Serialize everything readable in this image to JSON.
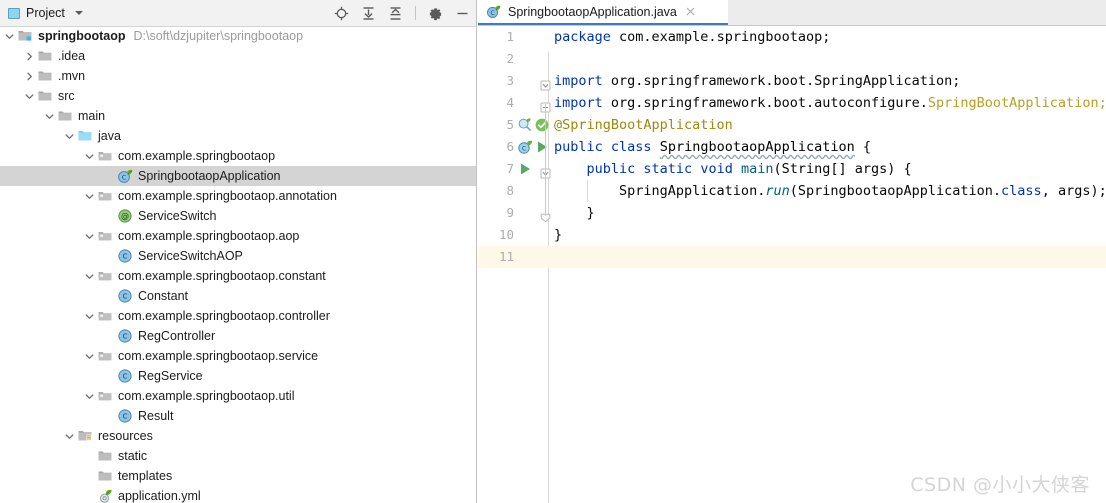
{
  "project_panel": {
    "title": "Project",
    "window_icon": "project-window-icon",
    "actions": [
      {
        "name": "locate-icon",
        "label": "Select Opened File"
      },
      {
        "name": "expand-all-icon",
        "label": "Expand All"
      },
      {
        "name": "collapse-all-icon",
        "label": "Collapse All"
      },
      {
        "name": "gear-icon",
        "label": "Options"
      },
      {
        "name": "minimize-icon",
        "label": "Hide"
      }
    ],
    "tree": [
      {
        "label": "springbootaop",
        "path": "D:\\soft\\dzjupiter\\springbootaop",
        "icon": "module-folder-icon",
        "arrow": "expanded",
        "depth": 0,
        "bold": true,
        "selected": false
      },
      {
        "label": ".idea",
        "path": "",
        "icon": "folder-icon",
        "arrow": "collapsed",
        "depth": 1,
        "bold": false,
        "selected": false
      },
      {
        "label": ".mvn",
        "path": "",
        "icon": "folder-icon",
        "arrow": "collapsed",
        "depth": 1,
        "bold": false,
        "selected": false
      },
      {
        "label": "src",
        "path": "",
        "icon": "folder-icon",
        "arrow": "expanded",
        "depth": 1,
        "bold": false,
        "selected": false
      },
      {
        "label": "main",
        "path": "",
        "icon": "folder-icon",
        "arrow": "expanded",
        "depth": 2,
        "bold": false,
        "selected": false
      },
      {
        "label": "java",
        "path": "",
        "icon": "source-folder-icon",
        "arrow": "expanded",
        "depth": 3,
        "bold": false,
        "selected": false
      },
      {
        "label": "com.example.springbootaop",
        "path": "",
        "icon": "package-icon",
        "arrow": "expanded",
        "depth": 4,
        "bold": false,
        "selected": false
      },
      {
        "label": "SpringbootaopApplication",
        "path": "",
        "icon": "spring-class-icon",
        "arrow": "none",
        "depth": 5,
        "bold": false,
        "selected": true
      },
      {
        "label": "com.example.springbootaop.annotation",
        "path": "",
        "icon": "package-icon",
        "arrow": "expanded",
        "depth": 4,
        "bold": false,
        "selected": false
      },
      {
        "label": "ServiceSwitch",
        "path": "",
        "icon": "annotation-class-icon",
        "arrow": "none",
        "depth": 5,
        "bold": false,
        "selected": false
      },
      {
        "label": "com.example.springbootaop.aop",
        "path": "",
        "icon": "package-icon",
        "arrow": "expanded",
        "depth": 4,
        "bold": false,
        "selected": false
      },
      {
        "label": "ServiceSwitchAOP",
        "path": "",
        "icon": "java-class-icon",
        "arrow": "none",
        "depth": 5,
        "bold": false,
        "selected": false
      },
      {
        "label": "com.example.springbootaop.constant",
        "path": "",
        "icon": "package-icon",
        "arrow": "expanded",
        "depth": 4,
        "bold": false,
        "selected": false
      },
      {
        "label": "Constant",
        "path": "",
        "icon": "java-class-icon",
        "arrow": "none",
        "depth": 5,
        "bold": false,
        "selected": false
      },
      {
        "label": "com.example.springbootaop.controller",
        "path": "",
        "icon": "package-icon",
        "arrow": "expanded",
        "depth": 4,
        "bold": false,
        "selected": false
      },
      {
        "label": "RegController",
        "path": "",
        "icon": "java-class-icon",
        "arrow": "none",
        "depth": 5,
        "bold": false,
        "selected": false
      },
      {
        "label": "com.example.springbootaop.service",
        "path": "",
        "icon": "package-icon",
        "arrow": "expanded",
        "depth": 4,
        "bold": false,
        "selected": false
      },
      {
        "label": "RegService",
        "path": "",
        "icon": "java-class-icon",
        "arrow": "none",
        "depth": 5,
        "bold": false,
        "selected": false
      },
      {
        "label": "com.example.springbootaop.util",
        "path": "",
        "icon": "package-icon",
        "arrow": "expanded",
        "depth": 4,
        "bold": false,
        "selected": false
      },
      {
        "label": "Result",
        "path": "",
        "icon": "java-class-icon",
        "arrow": "none",
        "depth": 5,
        "bold": false,
        "selected": false
      },
      {
        "label": "resources",
        "path": "",
        "icon": "resources-folder-icon",
        "arrow": "expanded",
        "depth": 3,
        "bold": false,
        "selected": false
      },
      {
        "label": "static",
        "path": "",
        "icon": "folder-icon",
        "arrow": "none",
        "depth": 4,
        "bold": false,
        "selected": false
      },
      {
        "label": "templates",
        "path": "",
        "icon": "folder-icon",
        "arrow": "none",
        "depth": 4,
        "bold": false,
        "selected": false
      },
      {
        "label": "application.yml",
        "path": "",
        "icon": "spring-yaml-icon",
        "arrow": "none",
        "depth": 4,
        "bold": false,
        "selected": false
      }
    ]
  },
  "editor": {
    "tab": {
      "title": "SpringbootaopApplication.java",
      "icon": "spring-class-icon",
      "close_icon": "close-icon"
    },
    "caret_line": 11,
    "lines": [
      {
        "num": "1",
        "fold": "none",
        "gutter": [],
        "tokens": [
          {
            "t": "package ",
            "c": "kw"
          },
          {
            "t": "com.example.springbootaop;",
            "c": "plain"
          }
        ],
        "indent": 0
      },
      {
        "num": "2",
        "fold": "none",
        "gutter": [],
        "tokens": [],
        "indent": 0
      },
      {
        "num": "3",
        "fold": "open",
        "gutter": [],
        "tokens": [
          {
            "t": "import ",
            "c": "kw"
          },
          {
            "t": "org.springframework.boot.SpringApplication;",
            "c": "plain"
          }
        ],
        "indent": 0
      },
      {
        "num": "4",
        "fold": "close",
        "gutter": [],
        "tokens": [
          {
            "t": "import ",
            "c": "kw"
          },
          {
            "t": "org.springframework.boot.autoconfigure.",
            "c": "plain"
          },
          {
            "t": "SpringBootApplication;",
            "c": "cls-ref"
          }
        ],
        "indent": 0
      },
      {
        "num": "5",
        "fold": "none",
        "gutter": [
          "bean-search-icon",
          "checkmark-icon"
        ],
        "tokens": [
          {
            "t": "@SpringBootApplication",
            "c": "anno"
          }
        ],
        "indent": 0
      },
      {
        "num": "6",
        "fold": "none",
        "gutter": [
          "spring-bean-icon",
          "run-icon"
        ],
        "tokens": [
          {
            "t": "public ",
            "c": "kw"
          },
          {
            "t": "class ",
            "c": "kw"
          },
          {
            "t": "SpringbootaopApplication",
            "c": "typo"
          },
          {
            "t": " {",
            "c": "plain"
          }
        ],
        "indent": 0
      },
      {
        "num": "7",
        "fold": "open",
        "gutter": [
          "run-icon"
        ],
        "tokens": [
          {
            "t": "    public ",
            "c": "kw"
          },
          {
            "t": "static ",
            "c": "kw"
          },
          {
            "t": "void ",
            "c": "kw"
          },
          {
            "t": "main",
            "c": "meth"
          },
          {
            "t": "(String[] args) {",
            "c": "plain"
          }
        ],
        "indent": 0
      },
      {
        "num": "8",
        "fold": "none",
        "gutter": [],
        "tokens": [
          {
            "t": "        SpringApplication.",
            "c": "plain"
          },
          {
            "t": "run",
            "c": "meth-i"
          },
          {
            "t": "(SpringbootaopApplication.",
            "c": "plain"
          },
          {
            "t": "class",
            "c": "kw"
          },
          {
            "t": ", args);",
            "c": "plain"
          }
        ],
        "indent": 0
      },
      {
        "num": "9",
        "fold": "end",
        "gutter": [],
        "tokens": [
          {
            "t": "    }",
            "c": "plain"
          }
        ],
        "indent": 0
      },
      {
        "num": "10",
        "fold": "none",
        "gutter": [],
        "tokens": [
          {
            "t": "}",
            "c": "plain"
          }
        ],
        "indent": 0
      },
      {
        "num": "11",
        "fold": "none",
        "gutter": [],
        "tokens": [],
        "indent": 0
      }
    ]
  },
  "watermark": {
    "text": "CSDN @小小大侠客"
  },
  "colors": {
    "keyword": "#0033b3",
    "annotation": "#9e880d",
    "class_ref": "#b8a024",
    "method": "#00627a",
    "selection": "#d4d4d4",
    "caret_line": "#fdf8e8",
    "tab_underline": "#3c7bbf",
    "toolbar_bg": "#f2f2f2",
    "tabbar_bg": "#ececec"
  }
}
